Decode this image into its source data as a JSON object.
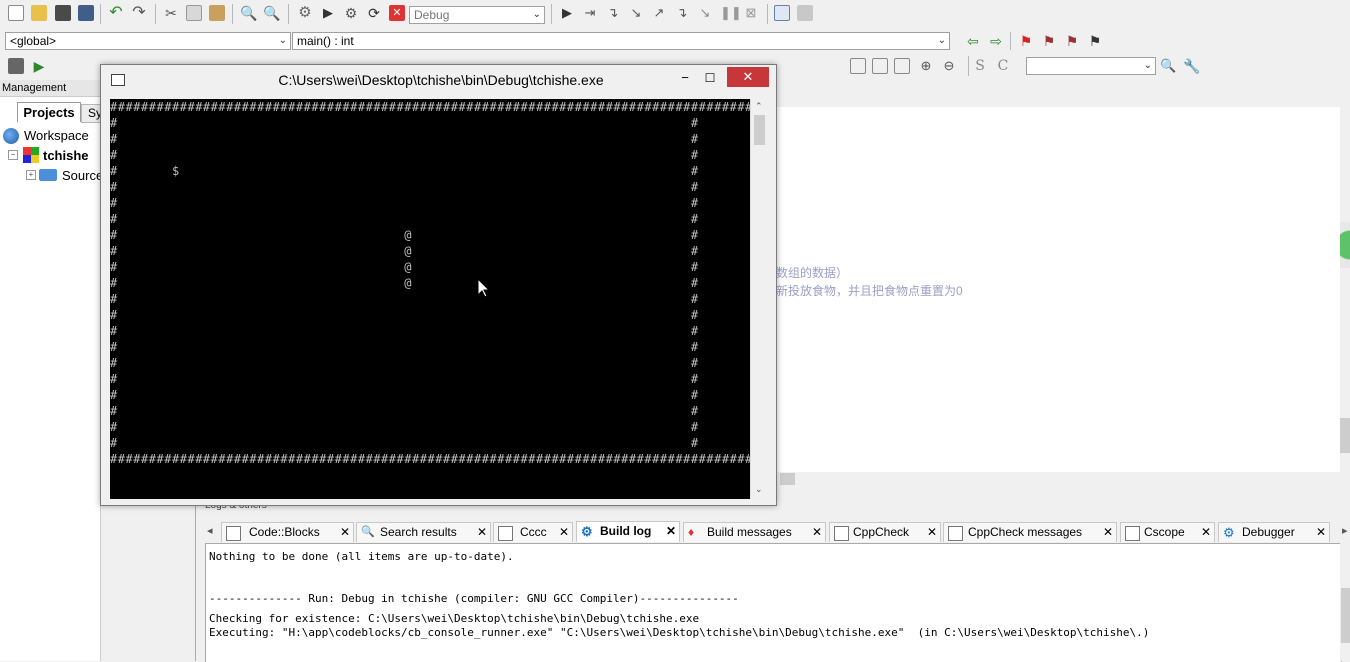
{
  "toolbar1": {
    "build_target": "Debug",
    "icons": [
      "new-file-icon",
      "open-icon",
      "save-icon",
      "save-all-icon",
      "undo-icon",
      "redo-icon",
      "cut-icon",
      "copy-icon",
      "paste-icon",
      "find-icon",
      "replace-icon",
      "build-icon",
      "run-icon",
      "build-run-icon",
      "rebuild-icon",
      "abort-icon"
    ],
    "debug_icons": [
      "debug-run-icon",
      "run-to-cursor-icon",
      "next-line-icon",
      "step-into-icon",
      "step-out-icon",
      "next-instruction-icon",
      "step-into-instruction-icon",
      "pause-icon",
      "stop-debug-icon",
      "debug-windows-icon",
      "info-icon"
    ]
  },
  "toolbar2": {
    "scope": "<global>",
    "function": "main() : int"
  },
  "toolbar3": {
    "comment_text": "/** *<"
  },
  "management": {
    "title": "Management",
    "tabs": [
      "Projects",
      "Sy"
    ],
    "tree": {
      "workspace": "Workspace",
      "project": "tchishe",
      "folder": "Sources"
    }
  },
  "console": {
    "title": "C:\\Users\\wei\\Desktop\\tchishe\\bin\\Debug\\tchishe.exe",
    "lines": [
      "################################################################################################",
      "#                                                                          #",
      "#                                                                          #",
      "#                                                                          #",
      "#       $                                                                  #",
      "#                                                                          #",
      "#                                                                          #",
      "#                                                                          #",
      "#                                     @                                    #",
      "#                                     @                                    #",
      "#                                     @                                    #",
      "#                                     @                                    #",
      "#                                                                          #",
      "#                                                                          #",
      "#                                                                          #",
      "#                                                                          #",
      "#                                                                          #",
      "#                                                                          #",
      "#                                                                          #",
      "#                                                                          #",
      "#                                                                          #",
      "#                                                                          #",
      "################################################################################################"
    ]
  },
  "editor": {
    "comment1": "数组的数据）",
    "comment2": "新投放食物，并且把食物点重置为0"
  },
  "logs": {
    "title": "Logs & others",
    "tabs": [
      "Code::Blocks",
      "Search results",
      "Cccc",
      "Build log",
      "Build messages",
      "CppCheck",
      "CppCheck messages",
      "Cscope",
      "Debugger"
    ],
    "active_tab": "Build log",
    "lines": [
      "Nothing to be done (all items are up-to-date).",
      "",
      "",
      "-------------- Run: Debug in tchishe (compiler: GNU GCC Compiler)---------------",
      "",
      "Checking for existence: C:\\Users\\wei\\Desktop\\tchishe\\bin\\Debug\\tchishe.exe",
      "Executing: \"H:\\app\\codeblocks/cb_console_runner.exe\" \"C:\\Users\\wei\\Desktop\\tchishe\\bin\\Debug\\tchishe.exe\"  (in C:\\Users\\wei\\Desktop\\tchishe\\.)"
    ]
  }
}
